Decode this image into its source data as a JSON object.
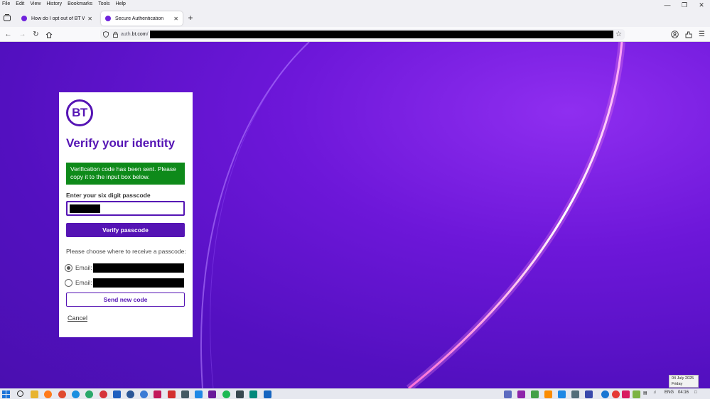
{
  "menubar": {
    "items": [
      "File",
      "Edit",
      "View",
      "History",
      "Bookmarks",
      "Tools",
      "Help"
    ]
  },
  "tabs": [
    {
      "title": "How do I opt out of BT Wi-Fi? | B",
      "active": false
    },
    {
      "title": "Secure Authentication",
      "active": true
    }
  ],
  "navbar": {
    "url_prefix": "auth.",
    "url_domain": "bt.com",
    "url_suffix": "/"
  },
  "card": {
    "logo_text": "BT",
    "title": "Verify your identity",
    "notice": "Verification code has been sent. Please copy it to the input box below.",
    "passcode_label": "Enter your six digit passcode",
    "verify_button": "Verify passcode",
    "choose_label": "Please choose where to receive a passcode:",
    "options": [
      {
        "label": "Email:",
        "checked": true
      },
      {
        "label": "Email:",
        "checked": false
      }
    ],
    "send_button": "Send new code",
    "cancel_link": "Cancel"
  },
  "colors": {
    "bt_purple": "#5514b4",
    "notice_green": "#0e8a1a"
  },
  "taskbar": {
    "language": "ENG",
    "time": "04:16",
    "date_tooltip_date": "04 July 2025",
    "date_tooltip_day": "Friday"
  }
}
